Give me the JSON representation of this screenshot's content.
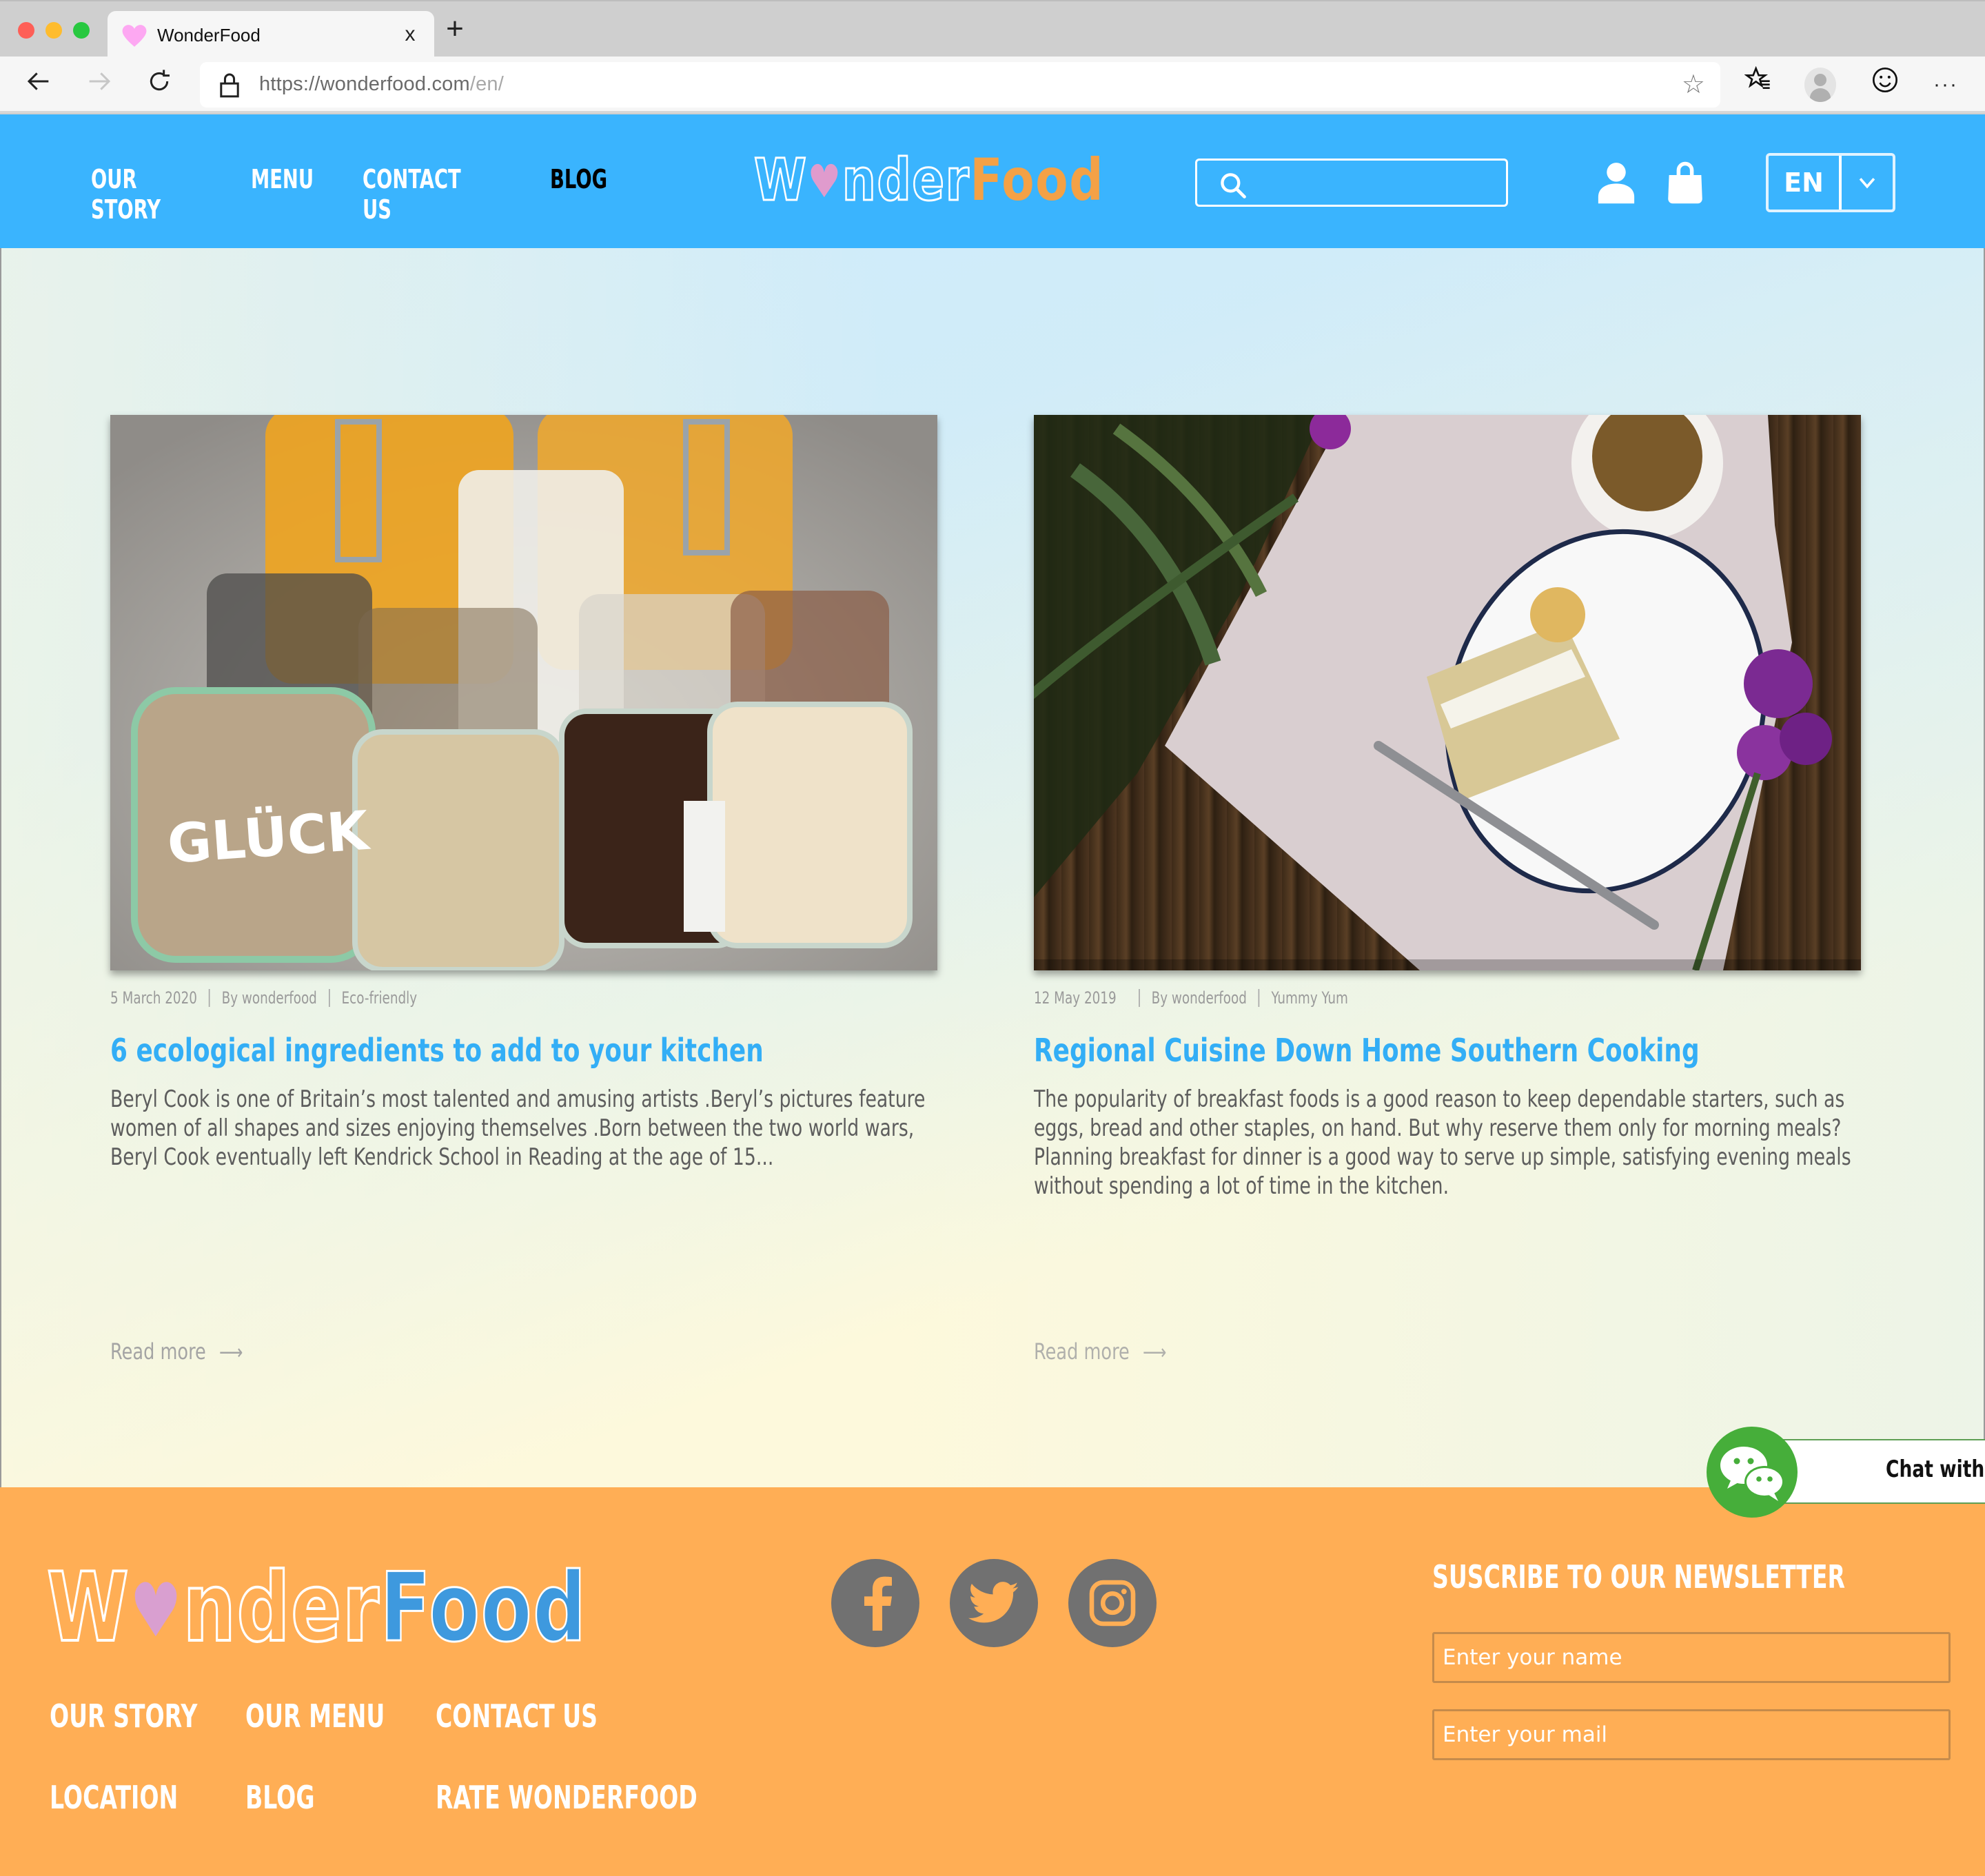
{
  "browser": {
    "tab_title": "WonderFood",
    "url_host": "https://wonderfood.com",
    "url_path": "/en/",
    "favicon": "heart-icon",
    "new_tab_label": "+",
    "close_tab_label": "x",
    "toolbar_icons": [
      "back-icon",
      "forward-icon",
      "reload-icon",
      "lock-icon",
      "add-favorite-star-icon",
      "favorites-icon",
      "profile-icon",
      "feedback-smiley-icon",
      "more-icon"
    ]
  },
  "header": {
    "nav": [
      {
        "label": "OUR STORY",
        "active": false
      },
      {
        "label": "MENU",
        "active": false
      },
      {
        "label": "CONTACT US",
        "active": false
      },
      {
        "label": "BLOG",
        "active": true
      }
    ],
    "logo": {
      "part1_prefix": "W",
      "part1_suffix": "nder",
      "part2": "Food"
    },
    "search": {
      "placeholder": "",
      "value": ""
    },
    "language": "EN",
    "colors": {
      "header_bg": "#3ab4fe",
      "active_nav": "#000000",
      "logo_accent": "#f4a146",
      "heart": "#e09bcd"
    }
  },
  "posts": [
    {
      "date": "5 March 2020",
      "author": "By wonderfood",
      "category": "Eco-friendly",
      "title": "6 ecological ingredients to add to your kitchen",
      "excerpt": "Beryl Cook is one of Britain’s most talented and amusing artists .Beryl’s pictures feature women of all shapes and sizes enjoying themselves .Born between the two world wars, Beryl Cook eventually left Kendrick School in Reading at the age of 15...",
      "read_more": "Read more",
      "image_alt": "Glass jars filled with nuts, almonds, chocolate, flour and cereals on sand"
    },
    {
      "date": "12 May 2019",
      "author": "By wonderfood",
      "category": "Yummy Yum",
      "title": "Regional Cuisine Down Home Southern Cooking",
      "excerpt": "The popularity of breakfast foods is a good reason to keep dependable starters, such as eggs, bread and other staples, on hand. But why reserve them only for morning meals? Planning breakfast for dinner is a good way to serve up simple, satisfying evening meals without spending a lot of time in the kitchen.",
      "read_more": "Read more",
      "image_alt": "Slice of cake on a white plate with a fork, flowers and coffee on a wooden table"
    }
  ],
  "chat": {
    "label": "Chat with us!",
    "icon": "wechat-icon",
    "color": "#46ae3a"
  },
  "footer": {
    "logo": {
      "part1_prefix": "W",
      "part1_suffix": "nder",
      "part2": "Food"
    },
    "links": [
      "OUR STORY",
      "OUR MENU",
      "CONTACT US",
      "LOCATION",
      "BLOG",
      "RATE WONDERFOOD"
    ],
    "social": [
      "facebook-icon",
      "twitter-icon",
      "instagram-icon"
    ],
    "newsletter": {
      "title": "SUSCRIBE TO OUR NEWSLETTER",
      "name_placeholder": "Enter your name",
      "mail_placeholder": "Enter your mail"
    },
    "colors": {
      "footer_bg": "#ffae55",
      "social_bg": "#717171",
      "logo_food": "#3e99de"
    }
  }
}
